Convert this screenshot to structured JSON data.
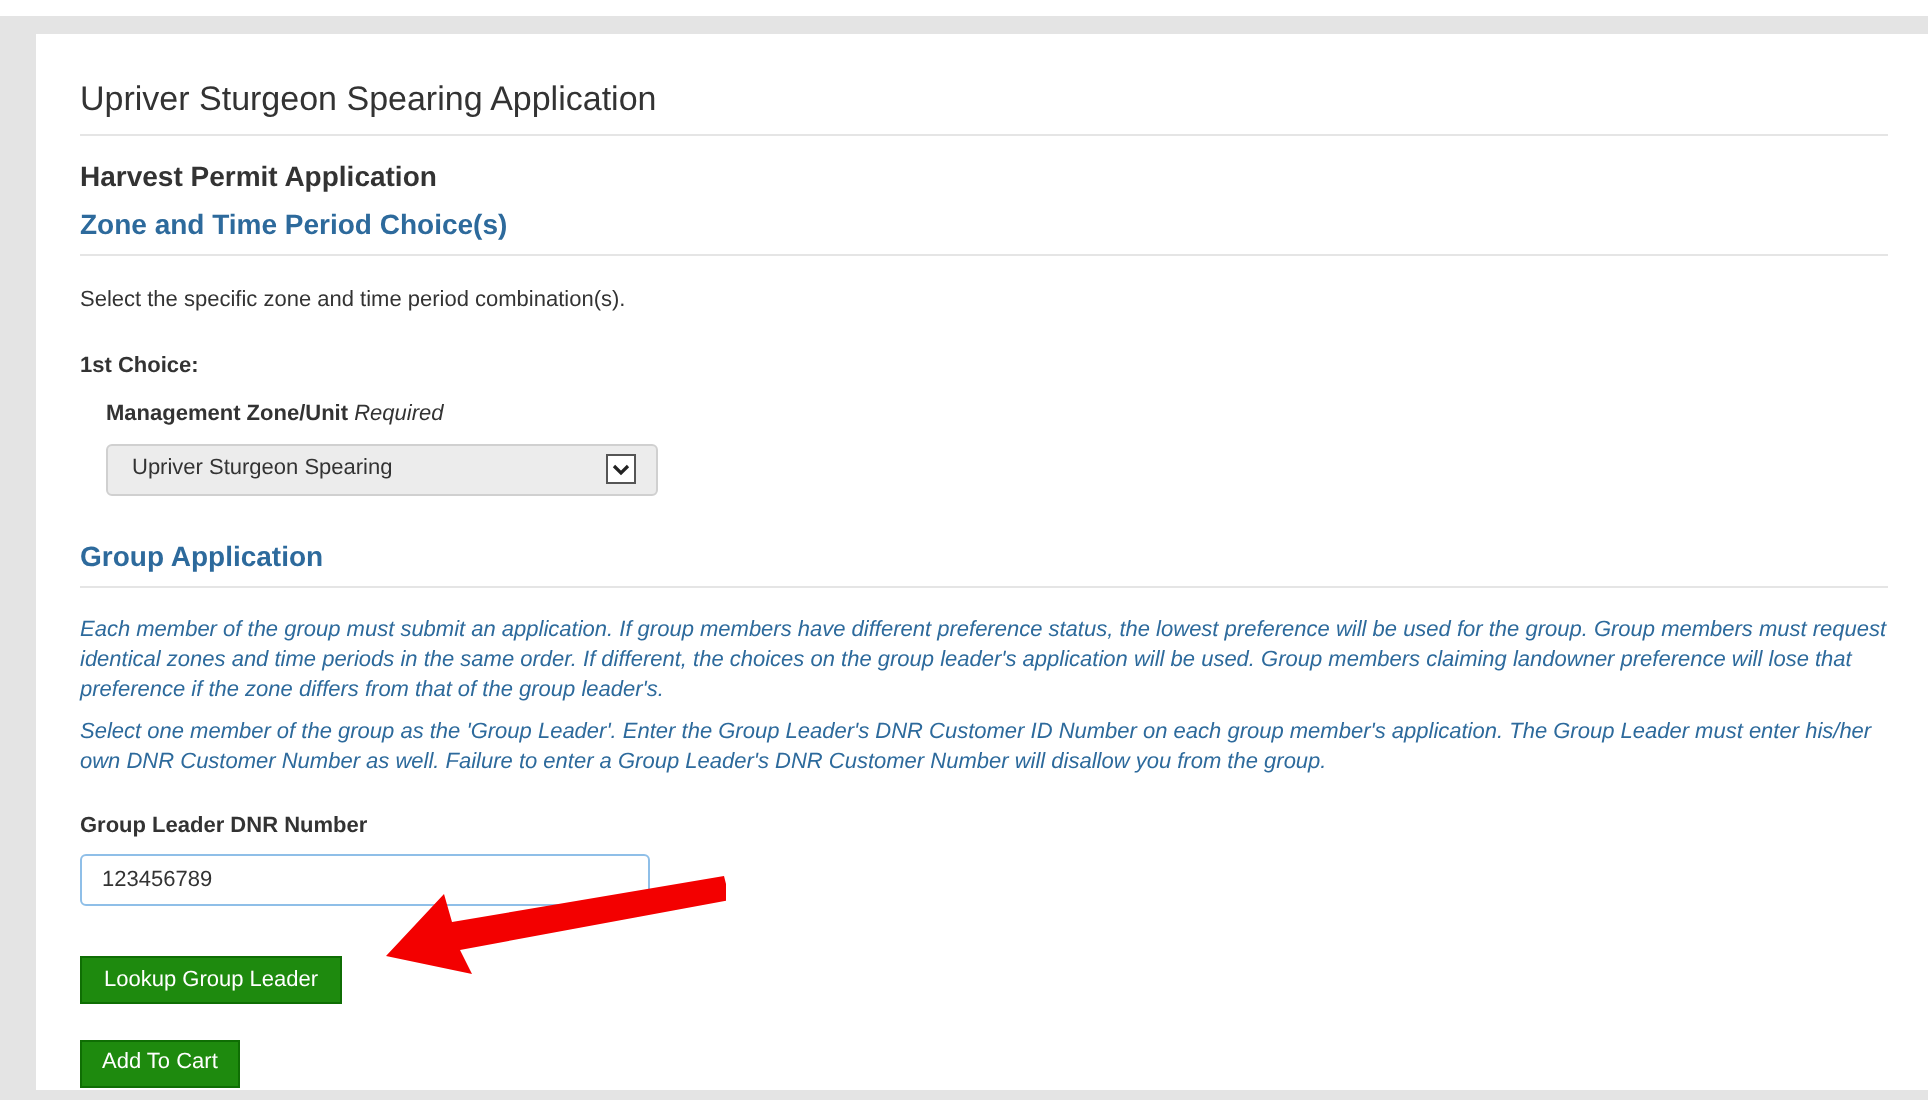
{
  "page_title": "Upriver Sturgeon Spearing Application",
  "subtitle": "Harvest Permit Application",
  "zone_section": {
    "heading": "Zone and Time Period Choice(s)",
    "instructions": "Select the specific zone and time period combination(s).",
    "choice_label": "1st Choice:",
    "field_label": "Management Zone/Unit",
    "required_note": "Required",
    "select_value": "Upriver Sturgeon Spearing"
  },
  "group_section": {
    "heading": "Group Application",
    "paragraphs": [
      "Each member of the group must submit an application. If group members have different preference status, the lowest preference will be used for the group. Group members must request identical zones and time periods in the same order. If different, the choices on the group leader's application will be used.  Group members claiming landowner preference will lose that preference if the zone differs from that of the group leader's.",
      "Select one member of the group as the 'Group Leader'. Enter the Group Leader's DNR Customer ID Number on each group member's application. The Group Leader must enter his/her own DNR Customer Number as well. Failure to enter a Group Leader's DNR Customer Number will disallow you from the group."
    ],
    "field_label": "Group Leader DNR Number",
    "field_value": "123456789",
    "lookup_button": "Lookup Group Leader"
  },
  "add_button": "Add To Cart"
}
